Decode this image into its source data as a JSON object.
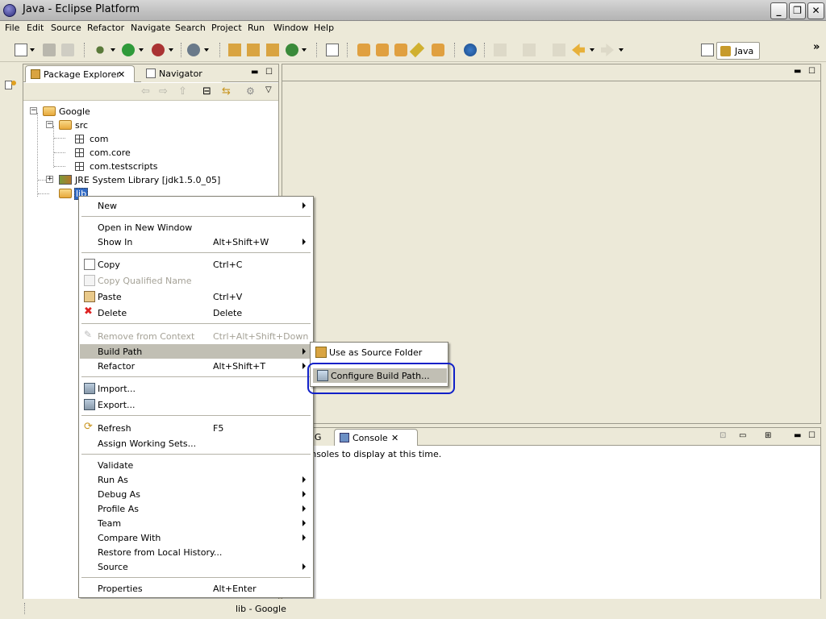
{
  "window": {
    "title": "Java - Eclipse Platform",
    "minimize": "_",
    "restore": "❐",
    "close": "✕"
  },
  "menubar": [
    "File",
    "Edit",
    "Source",
    "Refactor",
    "Navigate",
    "Search",
    "Project",
    "Run",
    "Window",
    "Help"
  ],
  "toolbar": {
    "perspective_label": "Java",
    "overflow": "»"
  },
  "package_explorer": {
    "tabs": [
      "Package Explorer",
      "Navigator"
    ],
    "tree": {
      "project": "Google",
      "src": "src",
      "packages": [
        "com",
        "com.core",
        "com.testscripts"
      ],
      "jre": "JRE System Library [jdk1.5.0_05]",
      "selected_folder": "lib"
    }
  },
  "console": {
    "tabs": [
      "TestNG",
      "Console"
    ],
    "message": "No consoles to display at this time."
  },
  "context_menu": {
    "items": [
      {
        "label": "New",
        "shortcut": "",
        "submenu": true,
        "disabled": false
      },
      {
        "label": "Open in New Window",
        "shortcut": "",
        "submenu": false,
        "disabled": false
      },
      {
        "label": "Show In",
        "shortcut": "Alt+Shift+W",
        "submenu": true,
        "disabled": false
      },
      {
        "label": "Copy",
        "shortcut": "Ctrl+C",
        "submenu": false,
        "disabled": false,
        "icon": "copy-icon"
      },
      {
        "label": "Copy Qualified Name",
        "shortcut": "",
        "submenu": false,
        "disabled": true,
        "icon": "copy-qualified-icon"
      },
      {
        "label": "Paste",
        "shortcut": "Ctrl+V",
        "submenu": false,
        "disabled": false,
        "icon": "paste-icon"
      },
      {
        "label": "Delete",
        "shortcut": "Delete",
        "submenu": false,
        "disabled": false,
        "icon": "delete-icon"
      },
      {
        "label": "Remove from Context",
        "shortcut": "Ctrl+Alt+Shift+Down",
        "submenu": false,
        "disabled": true,
        "icon": "remove-context-icon"
      },
      {
        "label": "Build Path",
        "shortcut": "",
        "submenu": true,
        "disabled": false,
        "highlighted": true
      },
      {
        "label": "Refactor",
        "shortcut": "Alt+Shift+T",
        "submenu": true,
        "disabled": false
      },
      {
        "label": "Import...",
        "shortcut": "",
        "submenu": false,
        "disabled": false,
        "icon": "import-icon"
      },
      {
        "label": "Export...",
        "shortcut": "",
        "submenu": false,
        "disabled": false,
        "icon": "export-icon"
      },
      {
        "label": "Refresh",
        "shortcut": "F5",
        "submenu": false,
        "disabled": false,
        "icon": "refresh-icon"
      },
      {
        "label": "Assign Working Sets...",
        "shortcut": "",
        "submenu": false,
        "disabled": false
      },
      {
        "label": "Validate",
        "shortcut": "",
        "submenu": false,
        "disabled": false
      },
      {
        "label": "Run As",
        "shortcut": "",
        "submenu": true,
        "disabled": false
      },
      {
        "label": "Debug As",
        "shortcut": "",
        "submenu": true,
        "disabled": false
      },
      {
        "label": "Profile As",
        "shortcut": "",
        "submenu": true,
        "disabled": false
      },
      {
        "label": "Team",
        "shortcut": "",
        "submenu": true,
        "disabled": false
      },
      {
        "label": "Compare With",
        "shortcut": "",
        "submenu": true,
        "disabled": false
      },
      {
        "label": "Restore from Local History...",
        "shortcut": "",
        "submenu": false,
        "disabled": false
      },
      {
        "label": "Source",
        "shortcut": "",
        "submenu": true,
        "disabled": false
      },
      {
        "label": "Properties",
        "shortcut": "Alt+Enter",
        "submenu": false,
        "disabled": false
      }
    ]
  },
  "build_path_submenu": {
    "items": [
      "Use as Source Folder",
      "Configure Build Path..."
    ]
  },
  "statusbar": {
    "text": "lib - Google"
  },
  "colors": {
    "chrome": "#ece9d8",
    "menu_highlight": "#c1bfb4",
    "focus_ring": "#1020c8"
  }
}
